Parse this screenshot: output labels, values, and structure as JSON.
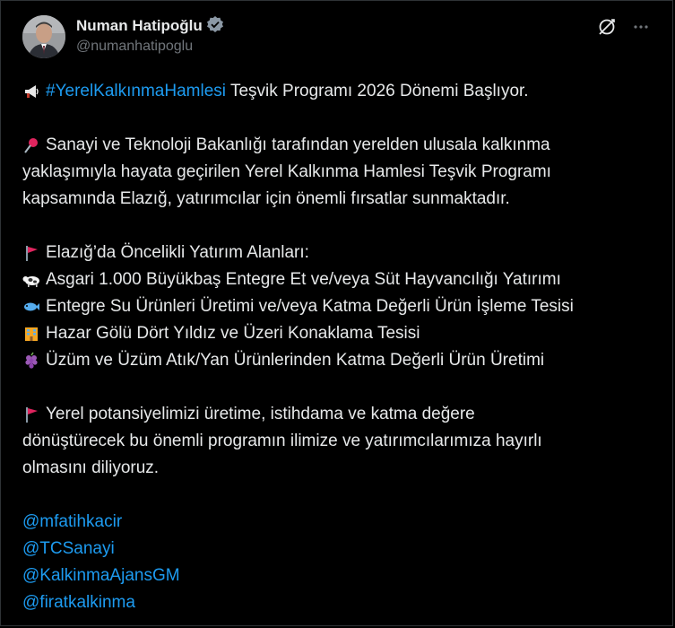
{
  "author": {
    "display_name": "Numan Hatipoğlu",
    "handle": "@numanhatipoglu",
    "verified_icon": "verified-badge-icon"
  },
  "actions": {
    "grok_icon": "grok-icon",
    "more_icon": "more-icon"
  },
  "tweet": {
    "line1_hashtag": "#YerelKalkınmaHamlesi",
    "line1_text": " Teşvik Programı 2026 Dönemi Başlıyor.",
    "p2_l1": "Sanayi ve Teknoloji Bakanlığı tarafından yerelden ulusala kalkınma",
    "p2_l2": "yaklaşımıyla hayata geçirilen Yerel Kalkınma Hamlesi Teşvik Programı",
    "p2_l3": "kapsamında Elazığ, yatırımcılar için önemli fırsatlar sunmaktadır.",
    "p3_head": "Elazığ’da Öncelikli Yatırım Alanları:",
    "items": [
      "Asgari 1.000 Büyükbaş Entegre Et ve/veya Süt Hayvancılığı Yatırımı",
      "Entegre Su Ürünleri Üretimi ve/veya Katma Değerli Ürün İşleme Tesisi",
      "Hazar Gölü Dört Yıldız ve Üzeri Konaklama Tesisi",
      "Üzüm ve Üzüm Atık/Yan Ürünlerinden Katma Değerli Ürün Üretimi"
    ],
    "p4_l1": "Yerel potansiyelimizi üretime, istihdama ve katma değere",
    "p4_l2": "dönüştürecek bu önemli programın ilimize ve yatırımcılarımıza hayırlı",
    "p4_l3": "olmasını diliyoruz.",
    "mentions": [
      "@mfatihkacir",
      "@TCSanayi",
      "@KalkinmaAjansGM",
      "@firatkalkinma"
    ]
  },
  "icons": {
    "megaphone": "megaphone-icon",
    "pin": "pushpin-icon",
    "flag": "red-flag-icon",
    "cow": "cow-icon",
    "fish": "fish-icon",
    "hotel": "hotel-icon",
    "grapes": "grapes-icon"
  },
  "colors": {
    "link": "#1d9bf0",
    "text": "#e7e9ea",
    "muted": "#71767b",
    "background": "#000000"
  }
}
